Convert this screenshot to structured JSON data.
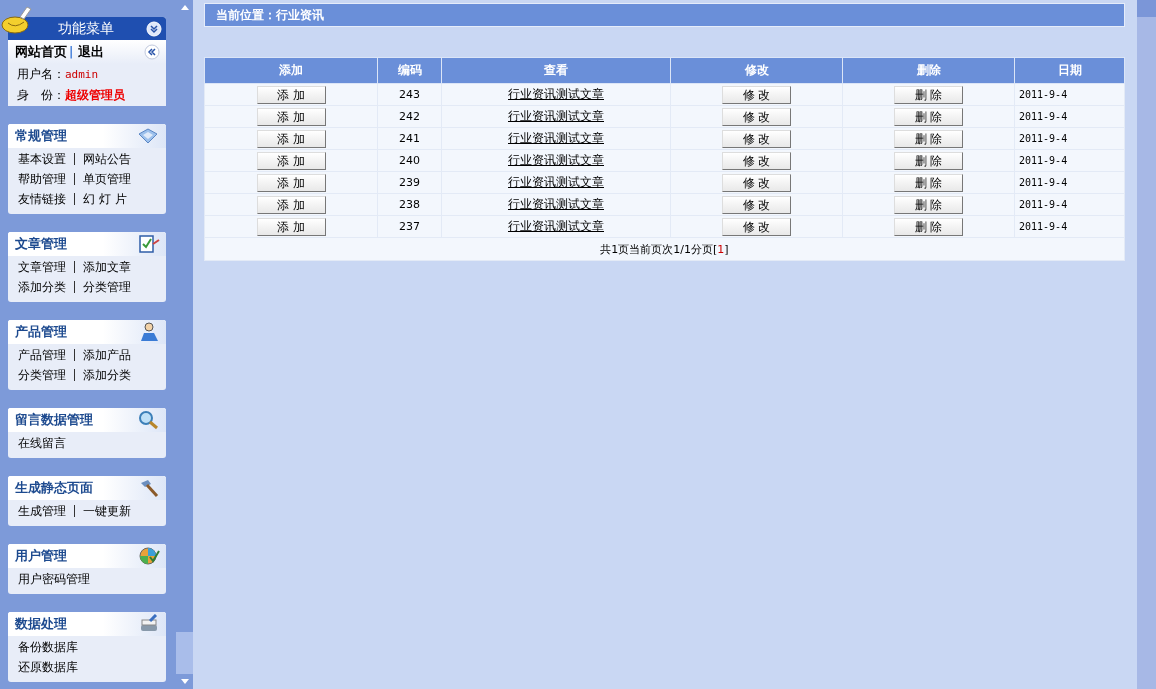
{
  "sidebar": {
    "menu_title": "功能菜单",
    "home_link": "网站首页",
    "separator": "|",
    "logout_link": "退出",
    "user_label": "用户名：",
    "username": "admin",
    "role_label": "身　份：",
    "role": "超级管理员",
    "sections": [
      {
        "title": "常规管理",
        "kind": "settings",
        "rows": [
          [
            "基本设置",
            "网站公告"
          ],
          [
            "帮助管理",
            "单页管理"
          ],
          [
            "友情链接",
            "幻 灯 片"
          ]
        ]
      },
      {
        "title": "文章管理",
        "kind": "article",
        "rows": [
          [
            "文章管理",
            "添加文章"
          ],
          [
            "添加分类",
            "分类管理"
          ]
        ]
      },
      {
        "title": "产品管理",
        "kind": "product",
        "rows": [
          [
            "产品管理",
            "添加产品"
          ],
          [
            "分类管理",
            "添加分类"
          ]
        ]
      },
      {
        "title": "留言数据管理",
        "kind": "message",
        "rows": [
          [
            "在线留言"
          ]
        ]
      },
      {
        "title": "生成静态页面",
        "kind": "static",
        "rows": [
          [
            "生成管理",
            "一键更新"
          ]
        ]
      },
      {
        "title": "用户管理",
        "kind": "user",
        "rows": [
          [
            "用户密码管理"
          ]
        ]
      },
      {
        "title": "数据处理",
        "kind": "data",
        "rows": [
          [
            "备份数据库"
          ],
          [
            "还原数据库"
          ]
        ]
      }
    ]
  },
  "breadcrumb": "当前位置：行业资讯",
  "table": {
    "columns": [
      "添加",
      "编码",
      "查看",
      "修改",
      "删除",
      "日期"
    ],
    "rows": [
      {
        "add": "添 加",
        "id": "243",
        "title": "行业资讯测试文章",
        "edit": "修 改",
        "delete": "删 除",
        "date": "2011-9-4"
      },
      {
        "add": "添 加",
        "id": "242",
        "title": "行业资讯测试文章",
        "edit": "修 改",
        "delete": "删 除",
        "date": "2011-9-4"
      },
      {
        "add": "添 加",
        "id": "241",
        "title": "行业资讯测试文章",
        "edit": "修 改",
        "delete": "删 除",
        "date": "2011-9-4"
      },
      {
        "add": "添 加",
        "id": "240",
        "title": "行业资讯测试文章",
        "edit": "修 改",
        "delete": "删 除",
        "date": "2011-9-4"
      },
      {
        "add": "添 加",
        "id": "239",
        "title": "行业资讯测试文章",
        "edit": "修 改",
        "delete": "删 除",
        "date": "2011-9-4"
      },
      {
        "add": "添 加",
        "id": "238",
        "title": "行业资讯测试文章",
        "edit": "修 改",
        "delete": "删 除",
        "date": "2011-9-4"
      },
      {
        "add": "添 加",
        "id": "237",
        "title": "行业资讯测试文章",
        "edit": "修 改",
        "delete": "删 除",
        "date": "2011-9-4"
      }
    ],
    "pagination": {
      "text": "共1页当前页次1/1分页[",
      "page": "1",
      "close": "]"
    }
  }
}
